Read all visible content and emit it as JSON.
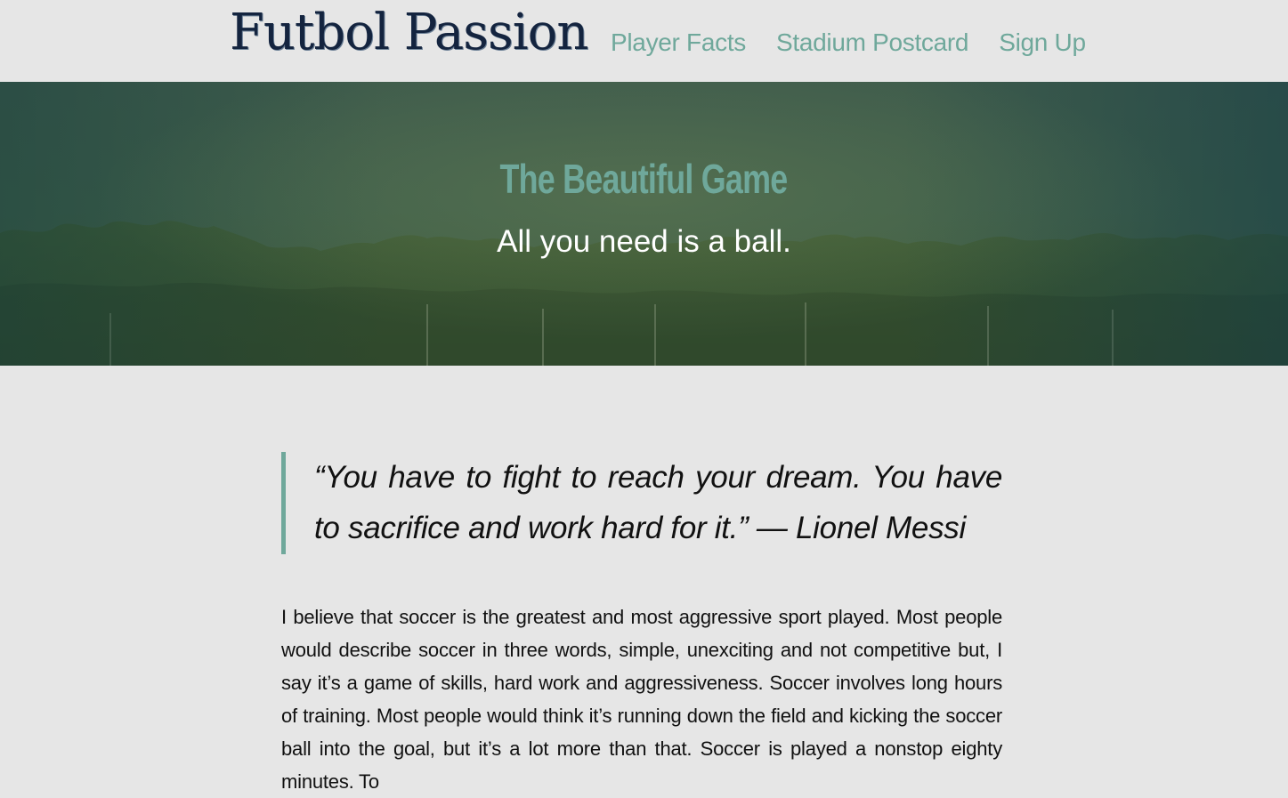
{
  "header": {
    "logo_text": "Futbol Passion",
    "nav": [
      {
        "label": "Player Facts"
      },
      {
        "label": "Stadium Postcard"
      },
      {
        "label": "Sign Up"
      }
    ]
  },
  "hero": {
    "title": "The Beautiful Game",
    "subtitle": "All you need is a ball."
  },
  "main": {
    "quote": "“You have to fight to reach your dream. You have to sacrifice and work hard for it.” — Lionel Messi",
    "paragraph": "I believe that soccer is the greatest and most aggressive sport played. Most people would describe soccer in three words, simple, unexciting and not competitive but, I say it’s a game of skills, hard work and aggressiveness. Soccer involves long hours of training. Most people would think it’s running down the field and kicking the soccer ball into the goal, but it’s a lot more than that. Soccer is played a nonstop eighty minutes. To"
  },
  "colors": {
    "accent": "#6fa89b",
    "logo": "#14243f",
    "background": "#e6e6e6"
  }
}
